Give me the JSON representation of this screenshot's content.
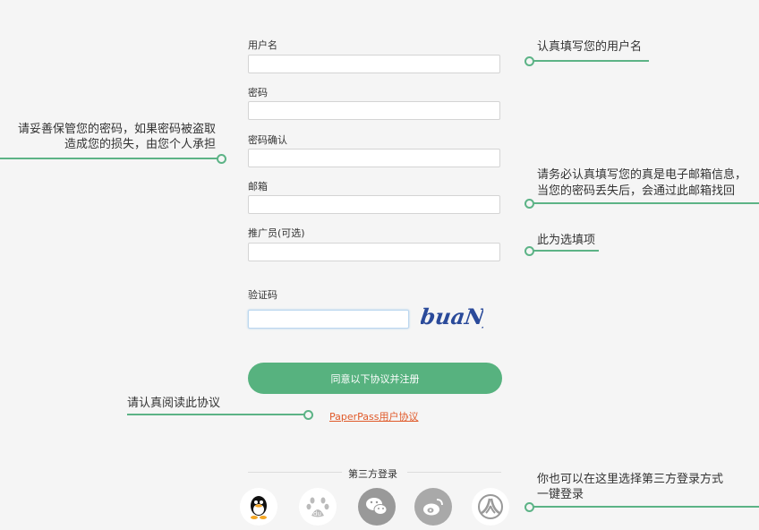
{
  "form": {
    "username_label": "用户名",
    "password_label": "密码",
    "confirm_label": "密码确认",
    "email_label": "邮箱",
    "referrer_label": "推广员(可选)",
    "captcha_label": "验证码",
    "captcha_image_text": "buaNf",
    "submit_label": "同意以下协议并注册",
    "agreement_link": "PaperPass用户协议"
  },
  "third_party": {
    "title": "第三方登录",
    "icons": [
      "qq-icon",
      "baidu-icon",
      "wechat-icon",
      "weibo-icon",
      "renren-icon"
    ]
  },
  "annotations": {
    "username": "认真填写您的用户名",
    "password_line1": "请妥善保管您的密码，如果密码被盗取",
    "password_line2": "造成您的损失，由您个人承担",
    "email_line1": "请务必认真填写您的真是电子邮箱信息，",
    "email_line2": "当您的密码丢失后，会通过此邮箱找回",
    "referrer": "此为选填项",
    "agreement": "请认真阅读此协议",
    "third_party_line1": "你也可以在这里选择第三方登录方式",
    "third_party_line2": "一键登录"
  },
  "colors": {
    "accent": "#57b27f",
    "link": "#e05a2a",
    "background": "#f5f5f5"
  }
}
